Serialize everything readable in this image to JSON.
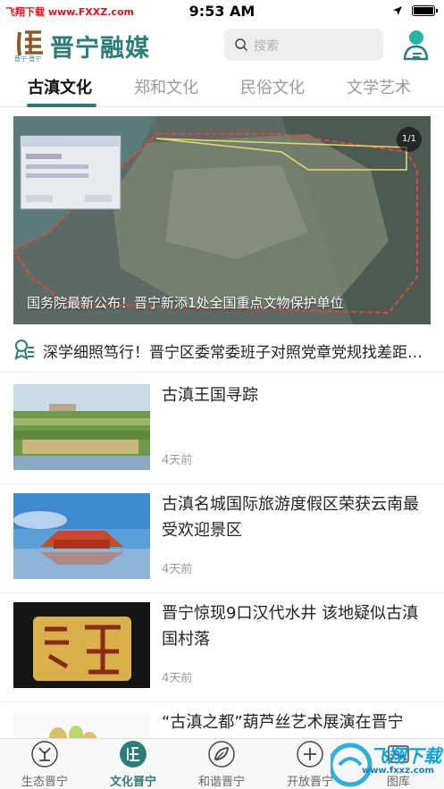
{
  "status_bar": {
    "site_label": "飞翔下载 www.FXXZ.com",
    "time": "9:53 AM"
  },
  "header": {
    "logo_subtitle": "晋宁·晋宁",
    "app_title": "晋宁融媒",
    "search_placeholder": "搜索"
  },
  "tabs": [
    {
      "label": "古滇文化",
      "active": true
    },
    {
      "label": "郑和文化",
      "active": false
    },
    {
      "label": "民俗文化",
      "active": false
    },
    {
      "label": "文学艺术",
      "active": false
    }
  ],
  "hero": {
    "caption": "国务院最新公布！晋宁新添1处全国重点文物保护单位",
    "counter": "1/1"
  },
  "notice": {
    "text": "深学细照笃行！晋宁区委常委班子对照党章党规找差距专题会议"
  },
  "news": [
    {
      "title": "古滇王国寻踪",
      "time": "4天前"
    },
    {
      "title": "古滇名城国际旅游度假区荣获云南最受欢迎景区",
      "time": "4天前"
    },
    {
      "title": "晋宁惊现9口汉代水井 该地疑似古滇国村落",
      "time": "4天前"
    },
    {
      "title": "“古滇之都”葫芦丝艺术展演在晋宁",
      "time": ""
    }
  ],
  "bottom_nav": [
    {
      "label": "生态晋宁",
      "icon": "plant-icon",
      "active": false
    },
    {
      "label": "文化晋宁",
      "icon": "culture-icon",
      "active": true
    },
    {
      "label": "和谐晋宁",
      "icon": "leaf-icon",
      "active": false
    },
    {
      "label": "开放晋宁",
      "icon": "open-icon",
      "active": false
    },
    {
      "label": "图库",
      "icon": "gallery-icon",
      "active": false
    }
  ],
  "watermark": {
    "brand": "飞翔下载",
    "url": "www.fxxz.com"
  },
  "colors": {
    "accent": "#2c7d77",
    "watermark_red": "#e0121b",
    "watermark_blue": "#0fa1d6"
  }
}
